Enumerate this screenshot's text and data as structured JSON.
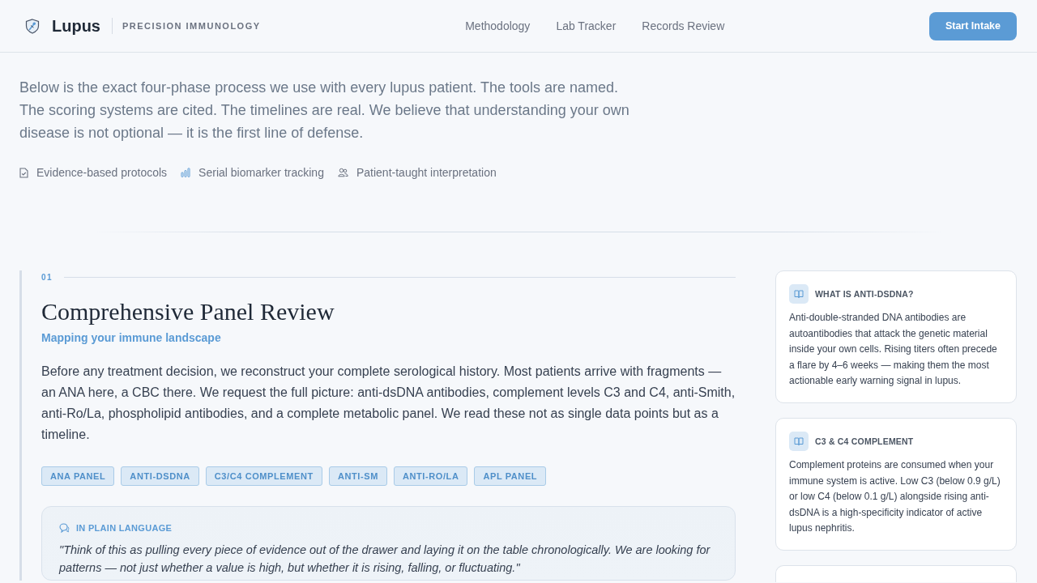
{
  "header": {
    "brand": "Lupus",
    "tagline": "PRECISION IMMUNOLOGY",
    "nav": [
      "Methodology",
      "Lab Tracker",
      "Records Review"
    ],
    "cta": "Start Intake"
  },
  "intro": {
    "text": "Below is the exact four-phase process we use with every lupus patient. The tools are named. The scoring systems are cited. The timelines are real. We believe that understanding your own disease is not optional — it is the first line of defense.",
    "features": [
      "Evidence-based protocols",
      "Serial biomarker tracking",
      "Patient-taught interpretation"
    ]
  },
  "phase": {
    "number": "01",
    "title": "Comprehensive Panel Review",
    "subtitle": "Mapping your immune landscape",
    "body": "Before any treatment decision, we reconstruct your complete serological history. Most patients arrive with fragments — an ANA here, a CBC there. We request the full picture: anti-dsDNA antibodies, complement levels C3 and C4, anti-Smith, anti-Ro/La, phospholipid antibodies, and a complete metabolic panel. We read these not as single data points but as a timeline.",
    "tags": [
      "ANA PANEL",
      "ANTI-DSDNA",
      "C3/C4 COMPLEMENT",
      "ANTI-SM",
      "ANTI-RO/LA",
      "APL PANEL"
    ],
    "plain_language": {
      "label": "IN PLAIN LANGUAGE",
      "quote": "\"Think of this as pulling every piece of evidence out of the drawer and laying it on the table chronologically. We are looking for patterns — not just whether a value is high, but whether it is rising, falling, or fluctuating.\""
    }
  },
  "sidebar": {
    "cards": [
      {
        "title": "WHAT IS ANTI-DSDNA?",
        "body": "Anti-double-stranded DNA antibodies are autoantibodies that attack the genetic material inside your own cells. Rising titers often precede a flare by 4–6 weeks — making them the most actionable early warning signal in lupus."
      },
      {
        "title": "C3 & C4 COMPLEMENT",
        "body": "Complement proteins are consumed when your immune system is active. Low C3 (below 0.9 g/L) or low C4 (below 0.1 g/L) alongside rising anti-dsDNA is a high-specificity indicator of active lupus nephritis."
      }
    ]
  }
}
